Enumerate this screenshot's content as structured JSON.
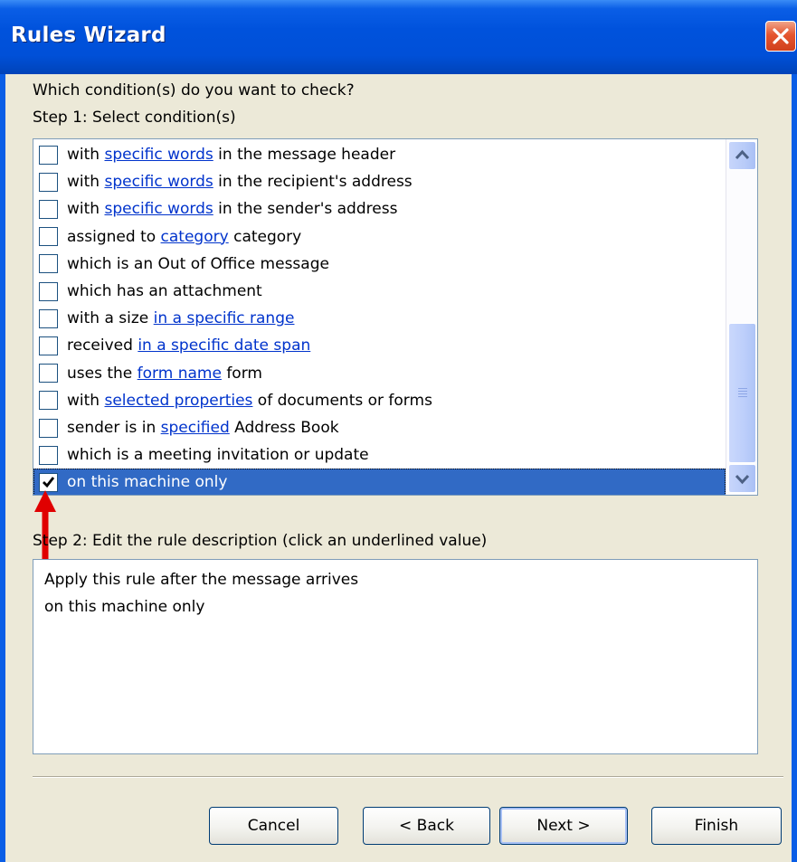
{
  "window": {
    "title": "Rules Wizard",
    "titlebar_color": "#0054e3",
    "selection_color": "#316ac5",
    "link_color": "#0033cc"
  },
  "prompt": "Which condition(s) do you want to check?",
  "step1": {
    "label": "Step 1: Select condition(s)",
    "conditions": [
      {
        "pre": "with ",
        "link": "specific words",
        "post": " in the message header",
        "checked": false
      },
      {
        "pre": "with ",
        "link": "specific words",
        "post": " in the recipient's address",
        "checked": false
      },
      {
        "pre": "with ",
        "link": "specific words",
        "post": " in the sender's address",
        "checked": false
      },
      {
        "pre": "assigned to ",
        "link": "category",
        "post": " category",
        "checked": false
      },
      {
        "pre": "which is an Out of Office message",
        "link": "",
        "post": "",
        "checked": false
      },
      {
        "pre": "which has an attachment",
        "link": "",
        "post": "",
        "checked": false
      },
      {
        "pre": "with a size ",
        "link": "in a specific range",
        "post": "",
        "checked": false
      },
      {
        "pre": "received ",
        "link": "in a specific date span",
        "post": "",
        "checked": false
      },
      {
        "pre": "uses the ",
        "link": "form name",
        "post": " form",
        "checked": false
      },
      {
        "pre": "with ",
        "link": "selected properties",
        "post": " of documents or forms",
        "checked": false
      },
      {
        "pre": "sender is in ",
        "link": "specified",
        "post": " Address Book",
        "checked": false
      },
      {
        "pre": "which is a meeting invitation or update",
        "link": "",
        "post": "",
        "checked": false
      },
      {
        "pre": "on this machine only",
        "link": "",
        "post": "",
        "checked": true,
        "selected": true
      }
    ]
  },
  "step2": {
    "label": "Step 2: Edit the rule description (click an underlined value)",
    "lines": [
      "Apply this rule after the message arrives",
      "on this machine only"
    ]
  },
  "buttons": {
    "cancel": "Cancel",
    "back": "< Back",
    "next": "Next >",
    "finish": "Finish"
  },
  "annotation": {
    "arrow_color": "#e00000",
    "arrow_icon": "red-up-arrow"
  }
}
